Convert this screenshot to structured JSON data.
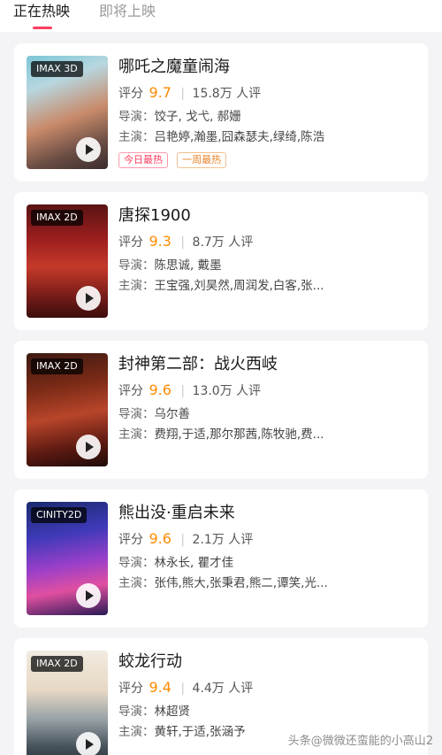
{
  "tabs": [
    {
      "label": "正在热映",
      "active": true
    },
    {
      "label": "即将上映",
      "active": false
    }
  ],
  "colors": {
    "accent": "#ff3c5f",
    "score": "#ff8a00"
  },
  "movies": [
    {
      "format": "IMAX 3D",
      "title": "哪吒之魔童闹海",
      "score_label": "评分",
      "score": "9.7",
      "reviews": "15.8万 人评",
      "director_label": "导演：",
      "director": "饺子, 戈弋, 郝姗",
      "cast_label": "主演：",
      "cast": "吕艳婷,瀚墨,囧森瑟夫,绿绮,陈浩",
      "tags": [
        "今日最热",
        "一周最热"
      ]
    },
    {
      "format": "IMAX 2D",
      "title": "唐探1900",
      "score_label": "评分",
      "score": "9.3",
      "reviews": "8.7万 人评",
      "director_label": "导演：",
      "director": "陈思诚, 戴墨",
      "cast_label": "主演：",
      "cast": "王宝强,刘昊然,周润发,白客,张..."
    },
    {
      "format": "IMAX 2D",
      "title": "封神第二部：战火西岐",
      "score_label": "评分",
      "score": "9.6",
      "reviews": "13.0万 人评",
      "director_label": "导演：",
      "director": "乌尔善",
      "cast_label": "主演：",
      "cast": "费翔,于适,那尔那茜,陈牧驰,费..."
    },
    {
      "format": "CINITY2D",
      "title": "熊出没·重启未来",
      "score_label": "评分",
      "score": "9.6",
      "reviews": "2.1万 人评",
      "director_label": "导演：",
      "director": "林永长, 瞿才佳",
      "cast_label": "主演：",
      "cast": "张伟,熊大,张秉君,熊二,谭笑,光..."
    },
    {
      "format": "IMAX 2D",
      "title": "蛟龙行动",
      "score_label": "评分",
      "score": "9.4",
      "reviews": "4.4万 人评",
      "director_label": "导演：",
      "director": "林超贤",
      "cast_label": "主演：",
      "cast": "黄轩,于适,张涵予"
    }
  ],
  "watermark": "头条@微微还蛮能的小高山2"
}
